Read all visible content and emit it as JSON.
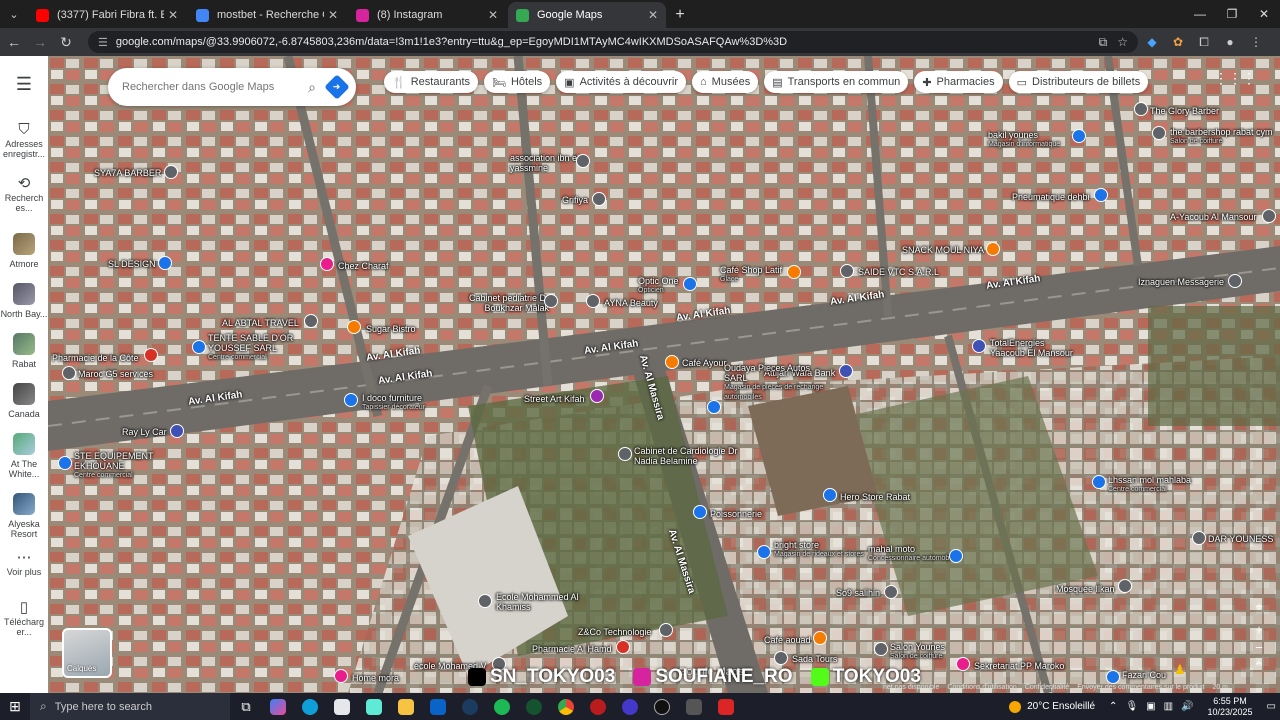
{
  "browser": {
    "tabs": [
      {
        "title": "(3377) Fabri Fibra ft. Emma, Bal",
        "color": "#ff0000",
        "icon": "youtube-icon",
        "active": false
      },
      {
        "title": "mostbet - Recherche Google",
        "color": "#4285f4",
        "icon": "google-icon",
        "active": false
      },
      {
        "title": "(8) Instagram",
        "color": "#d6249f",
        "icon": "instagram-icon",
        "active": false
      },
      {
        "title": "Google Maps",
        "color": "#34a853",
        "icon": "maps-icon",
        "active": true
      }
    ],
    "new_tab": "+",
    "url": "google.com/maps/@33.9906072,-6.8745803,236m/data=!3m1!1e3?entry=ttu&g_ep=EgoyMDI1MTAyMC4wIKXMDSoASAFQAw%3D%3D"
  },
  "maps": {
    "rail": {
      "items": [
        {
          "label": "Adresses enregistr...",
          "icon": "bookmark-icon"
        },
        {
          "label": "Recherch es...",
          "icon": "history-icon"
        },
        {
          "label": "Atmore",
          "icon": "thumb"
        },
        {
          "label": "North Bay...",
          "icon": "thumb"
        },
        {
          "label": "Rabat",
          "icon": "thumb"
        },
        {
          "label": "Canada",
          "icon": "thumb"
        },
        {
          "label": "At The White...",
          "icon": "thumb"
        },
        {
          "label": "Alyeska Resort",
          "icon": "thumb"
        },
        {
          "label": "Voir plus",
          "icon": "more-icon"
        },
        {
          "label": "Télécharg er...",
          "icon": "phone-icon"
        }
      ]
    },
    "search": {
      "placeholder": "Rechercher dans Google Maps"
    },
    "chips": [
      {
        "label": "Restaurants",
        "icon": "restaurant-icon"
      },
      {
        "label": "Hôtels",
        "icon": "hotel-icon"
      },
      {
        "label": "Activités à découvrir",
        "icon": "camera-icon"
      },
      {
        "label": "Musées",
        "icon": "museum-icon"
      },
      {
        "label": "Transports en commun",
        "icon": "transit-icon"
      },
      {
        "label": "Pharmacies",
        "icon": "pharmacy-icon"
      },
      {
        "label": "Distributeurs de billets",
        "icon": "atm-icon"
      }
    ],
    "places": [
      {
        "name": "SYA7A BARBER",
        "sub": "",
        "color": "#5f6368"
      },
      {
        "name": "SL DESIGN",
        "sub": "",
        "color": "#1a73e8"
      },
      {
        "name": "Chez Charaf",
        "sub": "",
        "color": "#e91e8c"
      },
      {
        "name": "association ibn el yassmine",
        "sub": "",
        "color": "#5f6368"
      },
      {
        "name": "Grifiya",
        "sub": "",
        "color": "#5f6368"
      },
      {
        "name": "AL ABTAL TRAVEL",
        "sub": "",
        "color": "#5f6368"
      },
      {
        "name": "Sugar Bistro",
        "sub": "",
        "color": "#f57c00"
      },
      {
        "name": "TENTE SABLE D'OR YOUSSEF SARL",
        "sub": "Centre commercial",
        "color": "#1a73e8"
      },
      {
        "name": "Pharmacie de la Côte",
        "sub": "",
        "color": "#d93025"
      },
      {
        "name": "Maroc G5 services",
        "sub": "",
        "color": "#5f6368"
      },
      {
        "name": "Cabinet pédiatrie Dr Boukhzar Malak",
        "sub": "",
        "color": "#5f6368"
      },
      {
        "name": "AYNA Beauty",
        "sub": "",
        "color": "#5f6368"
      },
      {
        "name": "Optic One",
        "sub": "Opticien",
        "color": "#1a73e8"
      },
      {
        "name": "Café Shop Latif",
        "sub": "Glace",
        "color": "#f57c00"
      },
      {
        "name": "SAIDE VTC S.A.R.L",
        "sub": "",
        "color": "#5f6368"
      },
      {
        "name": "SNACK MOUL NIYA",
        "sub": "",
        "color": "#f57c00"
      },
      {
        "name": "bakil younes",
        "sub": "Magasin d'informatique",
        "color": "#1a73e8"
      },
      {
        "name": "The Glory Barber",
        "sub": "",
        "color": "#5f6368"
      },
      {
        "name": "the barbershop rabat cym",
        "sub": "Salon de coiffure",
        "color": "#5f6368"
      },
      {
        "name": "Pneumatique dehbi",
        "sub": "",
        "color": "#1a73e8"
      },
      {
        "name": "A-Yacoub Al Mansour",
        "sub": "",
        "color": "#5f6368"
      },
      {
        "name": "Iznaguen Messagerie",
        "sub": "",
        "color": "#5f6368"
      },
      {
        "name": "TotalEnergies Yaacoub El Mansour",
        "sub": "",
        "color": "#3f51b5"
      },
      {
        "name": "Café Ayour",
        "sub": "",
        "color": "#f57c00"
      },
      {
        "name": "Attijari Wafa Bank",
        "sub": "",
        "color": "#3f51b5"
      },
      {
        "name": "I doco furniture",
        "sub": "Tapissier décorateur",
        "color": "#1a73e8"
      },
      {
        "name": "Street Art Kifah",
        "sub": "",
        "color": "#9c27b0"
      },
      {
        "name": "Oudaya Pieces Autos SARL",
        "sub": "Magasin de pièces de rechange automobiles",
        "color": "#1a73e8"
      },
      {
        "name": "Ray Ly Car",
        "sub": "",
        "color": "#3f51b5"
      },
      {
        "name": "STE EQUIPEMENT EKHOUANE",
        "sub": "Centre commercial",
        "color": "#1a73e8"
      },
      {
        "name": "Cabinet de Cardiologie Dr Nadia Belamine",
        "sub": "",
        "color": "#5f6368"
      },
      {
        "name": "Hero Store Rabat",
        "sub": "",
        "color": "#1a73e8"
      },
      {
        "name": "Lhssan mol mahlaba",
        "sub": "Centre commercial",
        "color": "#1a73e8"
      },
      {
        "name": "Poissonnerie",
        "sub": "",
        "color": "#1a73e8"
      },
      {
        "name": "bright store",
        "sub": "Magasin de rideaux et stores",
        "color": "#1a73e8"
      },
      {
        "name": "mahal moto",
        "sub": "Concessionnaire automobile",
        "color": "#1a73e8"
      },
      {
        "name": "DAR YOUNESS",
        "sub": "",
        "color": "#5f6368"
      },
      {
        "name": "So9 salihin",
        "sub": "",
        "color": "#5f6368"
      },
      {
        "name": "Mosquée Ilkan",
        "sub": "",
        "color": "#5f6368"
      },
      {
        "name": "Ecole Mohammed Al Khamiss",
        "sub": "",
        "color": "#5f6368"
      },
      {
        "name": "Z&Co Technologie",
        "sub": "",
        "color": "#5f6368"
      },
      {
        "name": "Pharmacie Al Hamd",
        "sub": "",
        "color": "#d93025"
      },
      {
        "name": "Café aouad",
        "sub": "",
        "color": "#f57c00"
      },
      {
        "name": "Sada Tours",
        "sub": "",
        "color": "#5f6368"
      },
      {
        "name": "Salon Younes",
        "sub": "Salon de coiffure",
        "color": "#5f6368"
      },
      {
        "name": "Sekretariat PP Maroko",
        "sub": "",
        "color": "#e91e8c"
      },
      {
        "name": "école Mohamed V",
        "sub": "",
        "color": "#5f6368"
      },
      {
        "name": "Home mora",
        "sub": "",
        "color": "#e91e8c"
      },
      {
        "name": "Fazari Cou",
        "sub": "",
        "color": "#1a73e8"
      }
    ],
    "roads": [
      "Av. Al Kifah",
      "Av. Al Kifah",
      "Av. Al Kifah",
      "Av. Al Kifah",
      "Av. Al Kifah",
      "Av. Al Kifah",
      "Av. Al Kifah",
      "Av. Al Massira",
      "Av. Al Massira"
    ],
    "layers_label": "Calques",
    "brand": "Google Maps",
    "watermark": [
      "SN_TOKYO03",
      "SOUFIANE_RO",
      "TOKYO03"
    ],
    "footer": [
      "net pas disponible",
      "Conditions d'utilisation",
      "Confidentialité",
      "Envoyer des commentaires sur le produit",
      "20 m"
    ]
  },
  "taskbar": {
    "search_placeholder": "Type here to search",
    "weather": "20°C  Ensoleillé",
    "time": "6:55 PM",
    "date": "10/23/2025"
  }
}
